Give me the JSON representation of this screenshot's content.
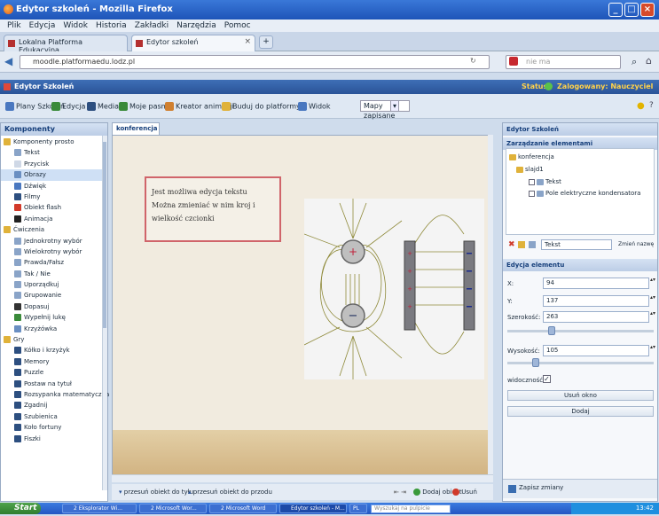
{
  "browser": {
    "title": "Edytor szkoleń - Mozilla Firefox",
    "menu": [
      "Plik",
      "Edycja",
      "Widok",
      "Historia",
      "Zakładki",
      "Narzędzia",
      "Pomoc"
    ],
    "tabs": [
      {
        "label": "Lokalna Platforma Edukacyjna"
      },
      {
        "label": "Edytor szkoleń"
      }
    ],
    "url": "moodle.platformaedu.lodz.pl",
    "search_placeholder": "nie ma"
  },
  "app": {
    "title": "Edytor Szkoleń",
    "user_status": "Status:",
    "user": "Zalogowany: Nauczyciel",
    "toolbar": [
      "Plany Szkoleń",
      "Edycja",
      "Media",
      "Moje pasmy",
      "Kreator animacji",
      "Buduj do platformy",
      "Widok",
      "Mapy zapisane"
    ],
    "map_select": "Mapy zapisane"
  },
  "left_panel": {
    "header": "Komponenty",
    "items": [
      {
        "label": "Komponenty prosto",
        "level": 0,
        "color": "#e0b23a"
      },
      {
        "label": "Tekst",
        "level": 1,
        "color": "#8aa4c8"
      },
      {
        "label": "Przycisk",
        "level": 1,
        "color": "#cfd8e6"
      },
      {
        "label": "Obrazy",
        "level": 1,
        "color": "#6a8fc2",
        "selected": true
      },
      {
        "label": "Dźwięk",
        "level": 1,
        "color": "#4a78c0"
      },
      {
        "label": "Filmy",
        "level": 1,
        "color": "#2d4f80"
      },
      {
        "label": "Obiekt flash",
        "level": 1,
        "color": "#d23a2a"
      },
      {
        "label": "Animacja",
        "level": 1,
        "color": "#222222"
      },
      {
        "label": "Ćwiczenia",
        "level": 0,
        "color": "#e0b23a"
      },
      {
        "label": "Jednokrotny wybór",
        "level": 1,
        "color": "#8aa4c8"
      },
      {
        "label": "Wielokrotny wybór",
        "level": 1,
        "color": "#8aa4c8"
      },
      {
        "label": "Prawda/Fałsz",
        "level": 1,
        "color": "#8aa4c8"
      },
      {
        "label": "Tak / Nie",
        "level": 1,
        "color": "#8aa4c8"
      },
      {
        "label": "Uporządkuj",
        "level": 1,
        "color": "#8aa4c8"
      },
      {
        "label": "Grupowanie",
        "level": 1,
        "color": "#8aa4c8"
      },
      {
        "label": "Dopasuj",
        "level": 1,
        "color": "#333333"
      },
      {
        "label": "Wypełnij lukę",
        "level": 1,
        "color": "#3a8a3a"
      },
      {
        "label": "Krzyżówka",
        "level": 1,
        "color": "#6a8fc2"
      },
      {
        "label": "Gry",
        "level": 0,
        "color": "#e0b23a"
      },
      {
        "label": "Kółko i krzyżyk",
        "level": 1,
        "color": "#2d4f80"
      },
      {
        "label": "Memory",
        "level": 1,
        "color": "#2d4f80"
      },
      {
        "label": "Puzzle",
        "level": 1,
        "color": "#2d4f80"
      },
      {
        "label": "Postaw na tytuł",
        "level": 1,
        "color": "#2d4f80"
      },
      {
        "label": "Rozsypanka matematyczna",
        "level": 1,
        "color": "#2d4f80"
      },
      {
        "label": "Zgadnij",
        "level": 1,
        "color": "#2d4f80"
      },
      {
        "label": "Szubienica",
        "level": 1,
        "color": "#2d4f80"
      },
      {
        "label": "Koło fortuny",
        "level": 1,
        "color": "#2d4f80"
      },
      {
        "label": "Fiszki",
        "level": 1,
        "color": "#2d4f80"
      }
    ]
  },
  "center": {
    "tab_label": "konferencja",
    "textbox_lines": [
      "Jest możliwa edycja tekstu",
      "Można zmieniać w nim kroj i",
      "wielkość czcionki"
    ],
    "footer_left": "przesuń obiekt do tyłu",
    "footer_mid": "przesuń obiekt do przodu",
    "footer_add": "Dodaj obiekt",
    "footer_del": "Usuń obiekt"
  },
  "right_panel": {
    "header": "Edytor Szkoleń",
    "manage_header": "Zarządzanie elementami",
    "tree": [
      {
        "label": "konferencja",
        "level": 0,
        "color": "#e0b23a"
      },
      {
        "label": "slajd1",
        "level": 1,
        "color": "#e0b23a"
      },
      {
        "label": "Tekst",
        "level": 2,
        "color": "#8aa4c8"
      },
      {
        "label": "Pole elektryczne kondensatora",
        "level": 2,
        "color": "#8aa4c8"
      }
    ],
    "name_value": "Tekst",
    "rename_button": "Zmień nazwę",
    "edit_header": "Edycja elementu",
    "fields": [
      {
        "label": "X:",
        "value": "94"
      },
      {
        "label": "Y:",
        "value": "137"
      },
      {
        "label": "Szerokość:",
        "value": "263"
      },
      {
        "label": "Wysokość:",
        "value": "105"
      }
    ],
    "visible_label": "widoczność:",
    "btn1": "Usuń okno",
    "btn2": "Dodaj",
    "footer": "Zapisz zmiany"
  },
  "taskbar": {
    "start": "Start",
    "tasks": [
      "2 Eksplorator Wi...",
      "2 Microsoft Wor...",
      "2 Microsoft Word",
      "Edytor szkoleń - M...",
      "PL"
    ],
    "search": "Wyszukaj na pulpicie",
    "time": "13:42"
  },
  "colors": {
    "accent": "#2a5398",
    "canvas": "#f1ebdf",
    "text_border": "#d0646a"
  }
}
